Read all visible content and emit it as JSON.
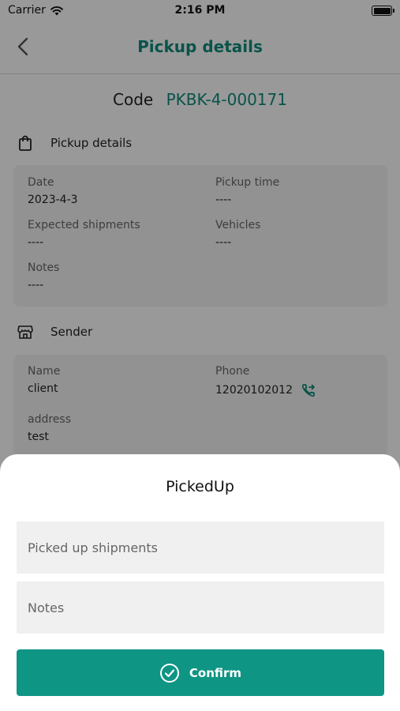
{
  "status_bar": {
    "carrier": "Carrier",
    "time": "2:16 PM"
  },
  "nav": {
    "title": "Pickup details"
  },
  "code": {
    "label": "Code",
    "value": "PKBK-4-000171"
  },
  "pickup_section": {
    "title": "Pickup details",
    "fields": {
      "date": {
        "label": "Date",
        "value": "2023-4-3"
      },
      "pickup_time": {
        "label": "Pickup time",
        "value": "----"
      },
      "expected_shipments": {
        "label": "Expected shipments",
        "value": "----"
      },
      "vehicles": {
        "label": "Vehicles",
        "value": "----"
      },
      "notes": {
        "label": "Notes",
        "value": "----"
      }
    }
  },
  "sender_section": {
    "title": "Sender",
    "fields": {
      "name": {
        "label": "Name",
        "value": "client"
      },
      "phone": {
        "label": "Phone",
        "value": "12020102012"
      },
      "address": {
        "label": "address",
        "value": "test"
      }
    }
  },
  "sheet": {
    "title": "PickedUp",
    "shipments_placeholder": "Picked up shipments",
    "notes_placeholder": "Notes",
    "confirm_label": "Confirm"
  },
  "colors": {
    "accent": "#0f8a7c",
    "button": "#0f9584"
  },
  "icons": {
    "back": "chevron-left-icon",
    "bag": "shopping-bag-icon",
    "store": "store-icon",
    "phone": "phone-forward-icon",
    "confirm": "check-circle-icon"
  }
}
